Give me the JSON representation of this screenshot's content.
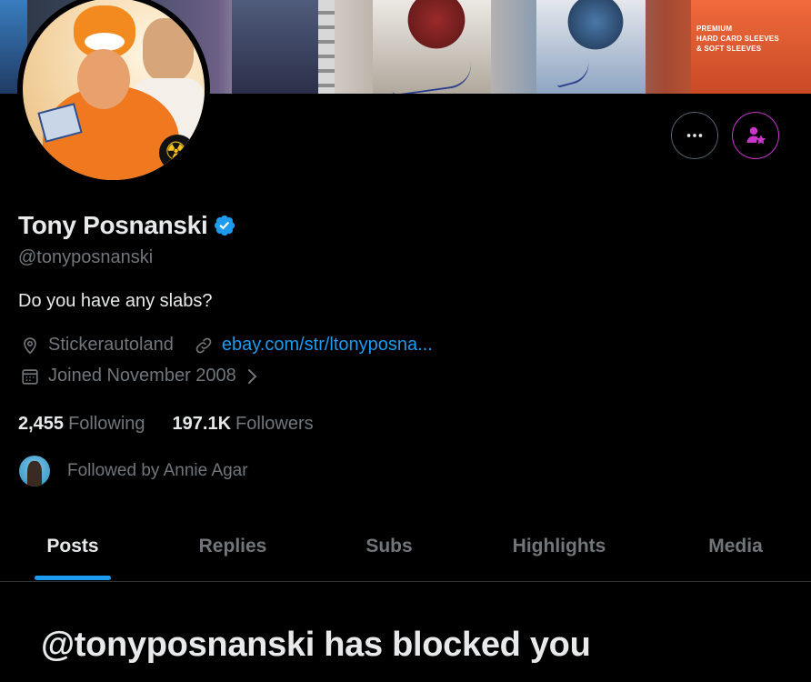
{
  "banner": {
    "sleeve_text": [
      "PREMIUM",
      "HARD CARD SLEEVES",
      "& SOFT SLEEVES"
    ]
  },
  "profile": {
    "name": "Tony Posnanski",
    "handle": "@tonyposnanski",
    "bio": "Do you have any slabs?",
    "location": "Stickerautoland",
    "link": "ebay.com/str/ltonyposna...",
    "joined": "Joined November 2008",
    "following_count": "2,455",
    "following_label": "Following",
    "followers_count": "197.1K",
    "followers_label": "Followers",
    "followed_by": "Followed by Annie Agar",
    "verified": true
  },
  "actions": {
    "more_icon": "more-horizontal-icon",
    "subscribe_icon": "person-star-icon"
  },
  "tabs": [
    {
      "label": "Posts",
      "active": true
    },
    {
      "label": "Replies",
      "active": false
    },
    {
      "label": "Subs",
      "active": false
    },
    {
      "label": "Highlights",
      "active": false
    },
    {
      "label": "Media",
      "active": false
    }
  ],
  "blocked_message": "@tonyposnanski has blocked you",
  "colors": {
    "accent": "#1d9bf0",
    "subscribe": "#c936cc",
    "muted": "#71767b",
    "text": "#e7e9ea",
    "background": "#000000"
  }
}
